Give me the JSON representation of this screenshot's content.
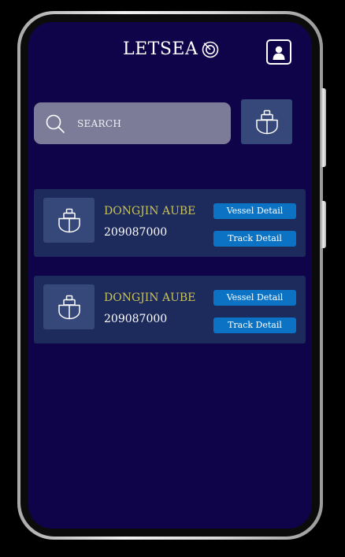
{
  "app": {
    "brand": "LETSEA",
    "search_placeholder": "SEARCH"
  },
  "vessels": [
    {
      "name": "DONGJIN AUBE",
      "number": "209087000",
      "vessel_detail_label": "Vessel Detail",
      "track_detail_label": "Track Detail"
    },
    {
      "name": "DONGJIN AUBE",
      "number": "209087000",
      "vessel_detail_label": "Vessel Detail",
      "track_detail_label": "Track Detail"
    }
  ],
  "icons": {
    "brand": "radar-icon",
    "profile": "user-profile-icon",
    "search": "search-icon",
    "vessel": "ship-icon"
  },
  "colors": {
    "background": "#0f044a",
    "card": "#1d2a5c",
    "thumb": "#364779",
    "search_box": "#7c7b98",
    "vessel_name": "#c9c35a",
    "button": "#0b72c4"
  }
}
